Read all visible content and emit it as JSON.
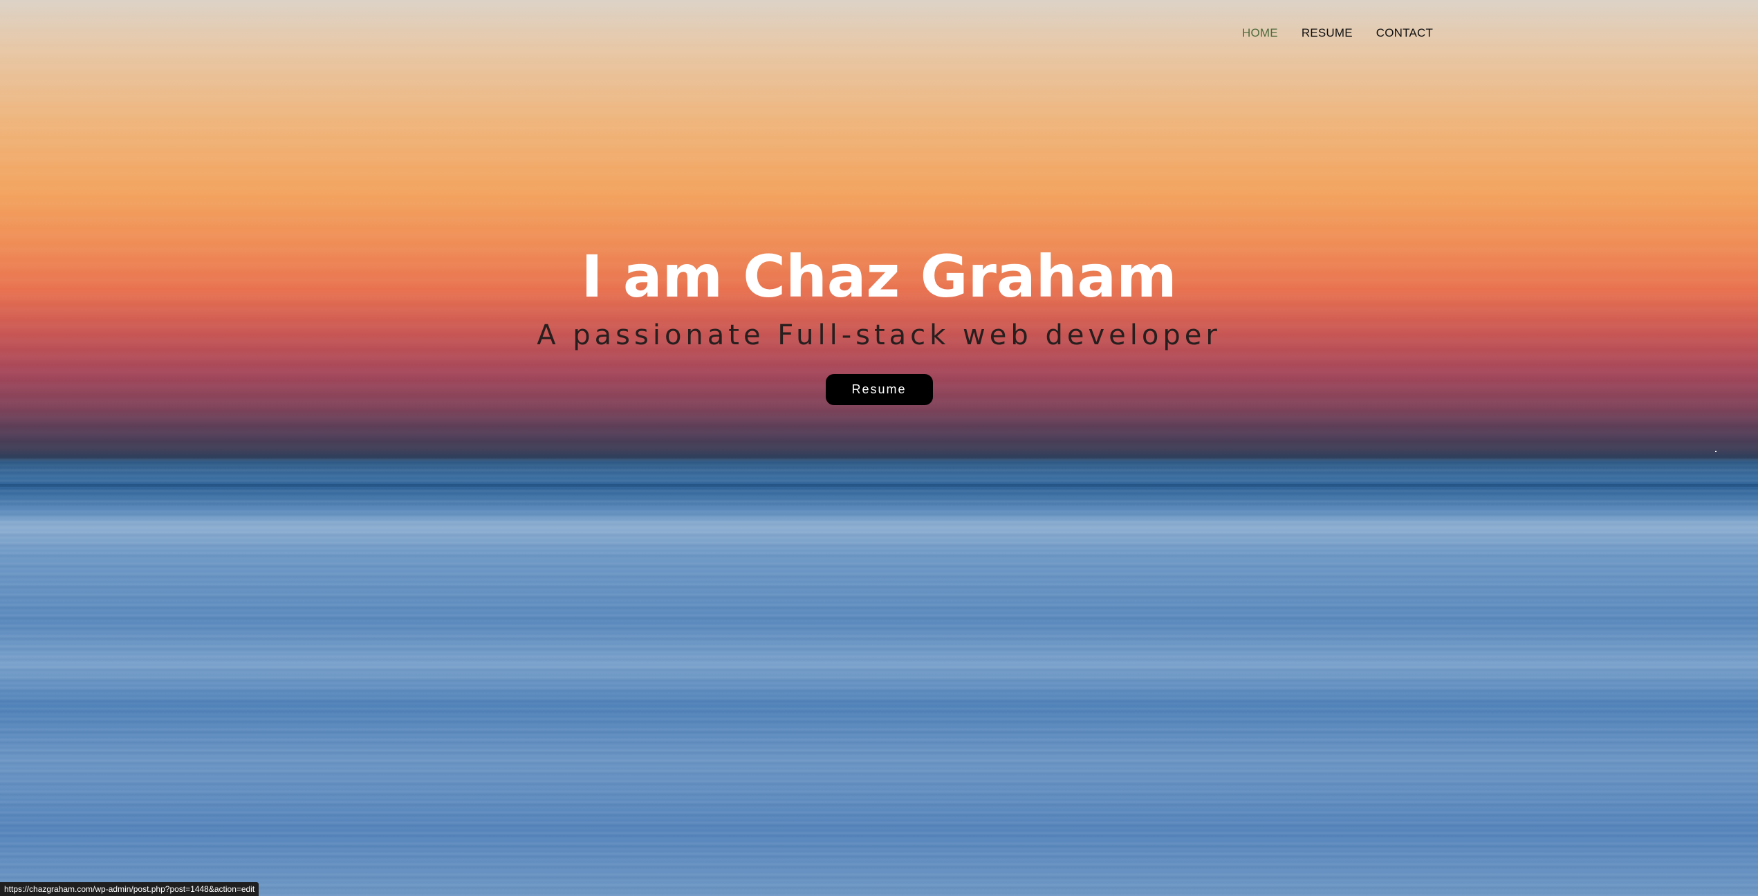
{
  "nav": {
    "items": [
      {
        "label": "HOME",
        "active": true
      },
      {
        "label": "RESUME",
        "active": false
      },
      {
        "label": "CONTACT",
        "active": false
      }
    ],
    "active_color": "#4e6b3e"
  },
  "hero": {
    "title": "I am Chaz Graham",
    "subtitle": "A passionate Full-stack web developer",
    "button_label": "Resume"
  },
  "status_bar": {
    "url": "https://chazgraham.com/wp-admin/post.php?post=1448&action=edit"
  }
}
